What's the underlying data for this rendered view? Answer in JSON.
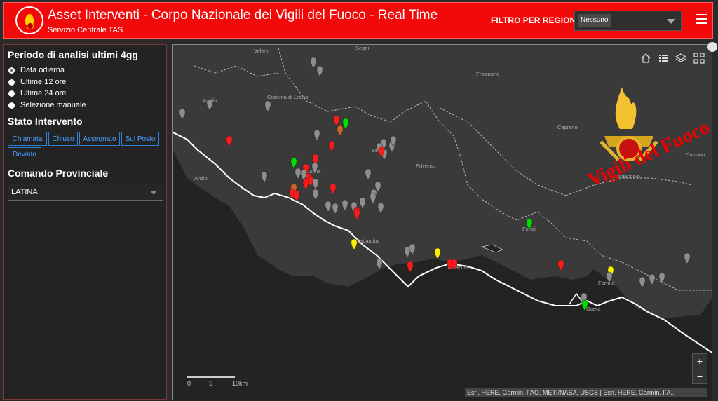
{
  "header": {
    "title": "Asset Interventi - Corpo Nazionale dei Vigili del Fuoco - Real Time",
    "subtitle": "Servizio Centrale TAS",
    "filter_label": "FILTRO PER REGIONE",
    "region_value": "Nessuno",
    "menu_icon": "hamburger-icon",
    "logo_icon": "vvf-emblem-icon"
  },
  "sidebar": {
    "period_title": "Periodo di analisi ultimi 4gg",
    "period_options": [
      "Data odierna",
      "Ultime 12 ore",
      "Ultime 24 ore",
      "Selezione manuale"
    ],
    "period_selected": "Data odierna",
    "status_title": "Stato Intervento",
    "status_buttons": [
      "Chiamata",
      "Chiuso",
      "Assegnato",
      "Sul Posto",
      "Deviato"
    ],
    "command_title": "Comando Provinciale",
    "command_value": "LATINA"
  },
  "map": {
    "places": [
      "Segni",
      "Velletri",
      "Frosinone",
      "Aprilia",
      "Cisterna di Latina",
      "Sezze",
      "Ceprano",
      "Latina",
      "Priverno",
      "Cassino",
      "Anzio",
      "Pontecorvo",
      "Fondi",
      "Sabaudia",
      "Terracina",
      "Formia",
      "Gaeta"
    ],
    "scale": {
      "labels": [
        "0",
        "5",
        "10km"
      ]
    },
    "attribution": "Esri, HERE, Garmin, FAO, METI/NASA, USGS | Esri, HERE, Garmin, FA...",
    "zoom_in": "+",
    "zoom_out": "−",
    "brand_text": "Vigili del Fuoco",
    "toolbar_icons": [
      "home-icon",
      "list-icon",
      "layers-icon",
      "qr-icon"
    ],
    "colors": {
      "chiamata": "#ff1a1a",
      "assegnato": "#ffee00",
      "sul_posto": "#00e000",
      "deviato": "#c8642a",
      "chiuso": "#8e8e8e"
    }
  }
}
